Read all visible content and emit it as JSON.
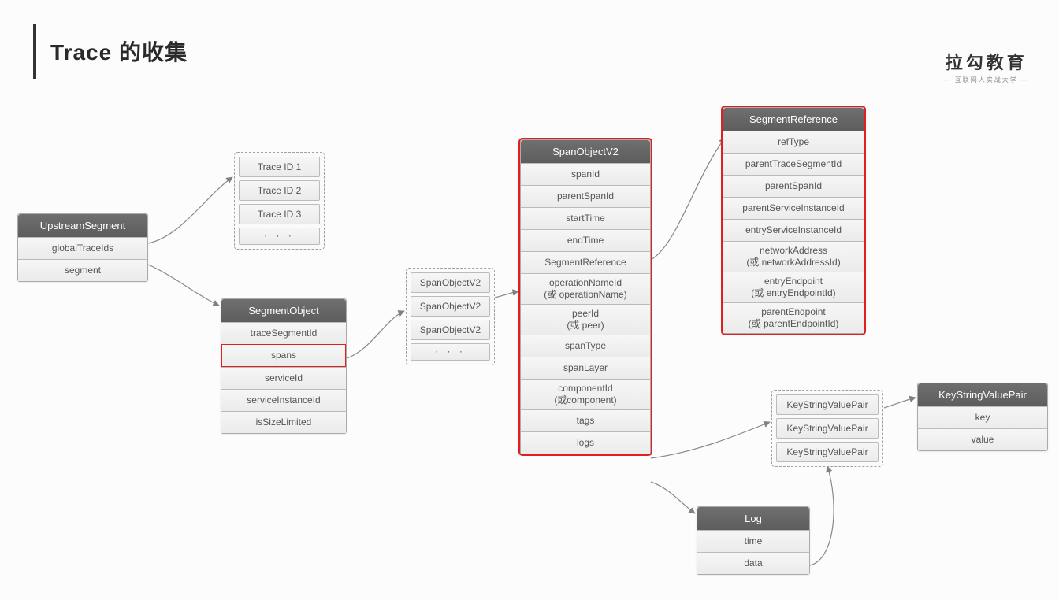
{
  "title": "Trace 的收集",
  "brand": {
    "big": "拉勾教育",
    "small": "— 互联网人实战大学 —"
  },
  "upstream": {
    "header": "UpstreamSegment",
    "rows": [
      "globalTraceIds",
      "segment"
    ]
  },
  "traceids": {
    "items": [
      "Trace ID 1",
      "Trace ID 2",
      "Trace ID 3",
      "· · ·"
    ]
  },
  "segmentObject": {
    "header": "SegmentObject",
    "rows": [
      "traceSegmentId",
      "spans",
      "serviceId",
      "serviceInstanceId",
      "isSizeLimited"
    ]
  },
  "spanList": {
    "items": [
      "SpanObjectV2",
      "SpanObjectV2",
      "SpanObjectV2",
      "· · ·"
    ]
  },
  "spanObject": {
    "header": "SpanObjectV2",
    "rows": [
      "spanId",
      "parentSpanId",
      "startTime",
      "endTime",
      "SegmentReference",
      "operationNameId\n(或 operationName)",
      "peerId\n(或 peer)",
      "spanType",
      "spanLayer",
      "componentId\n(或component)",
      "tags",
      "logs"
    ]
  },
  "segmentReference": {
    "header": "SegmentReference",
    "rows": [
      "refType",
      "parentTraceSegmentId",
      "parentSpanId",
      "parentServiceInstanceId",
      "entryServiceInstanceId",
      "networkAddress\n(或 networkAddressId)",
      "entryEndpoint\n(或 entryEndpointId)",
      "parentEndpoint\n(或 parentEndpointId)"
    ]
  },
  "log": {
    "header": "Log",
    "rows": [
      "time",
      "data"
    ]
  },
  "kvList": {
    "items": [
      "KeyStringValuePair",
      "KeyStringValuePair",
      "KeyStringValuePair"
    ]
  },
  "kvPair": {
    "header": "KeyStringValuePair",
    "rows": [
      "key",
      "value"
    ]
  }
}
